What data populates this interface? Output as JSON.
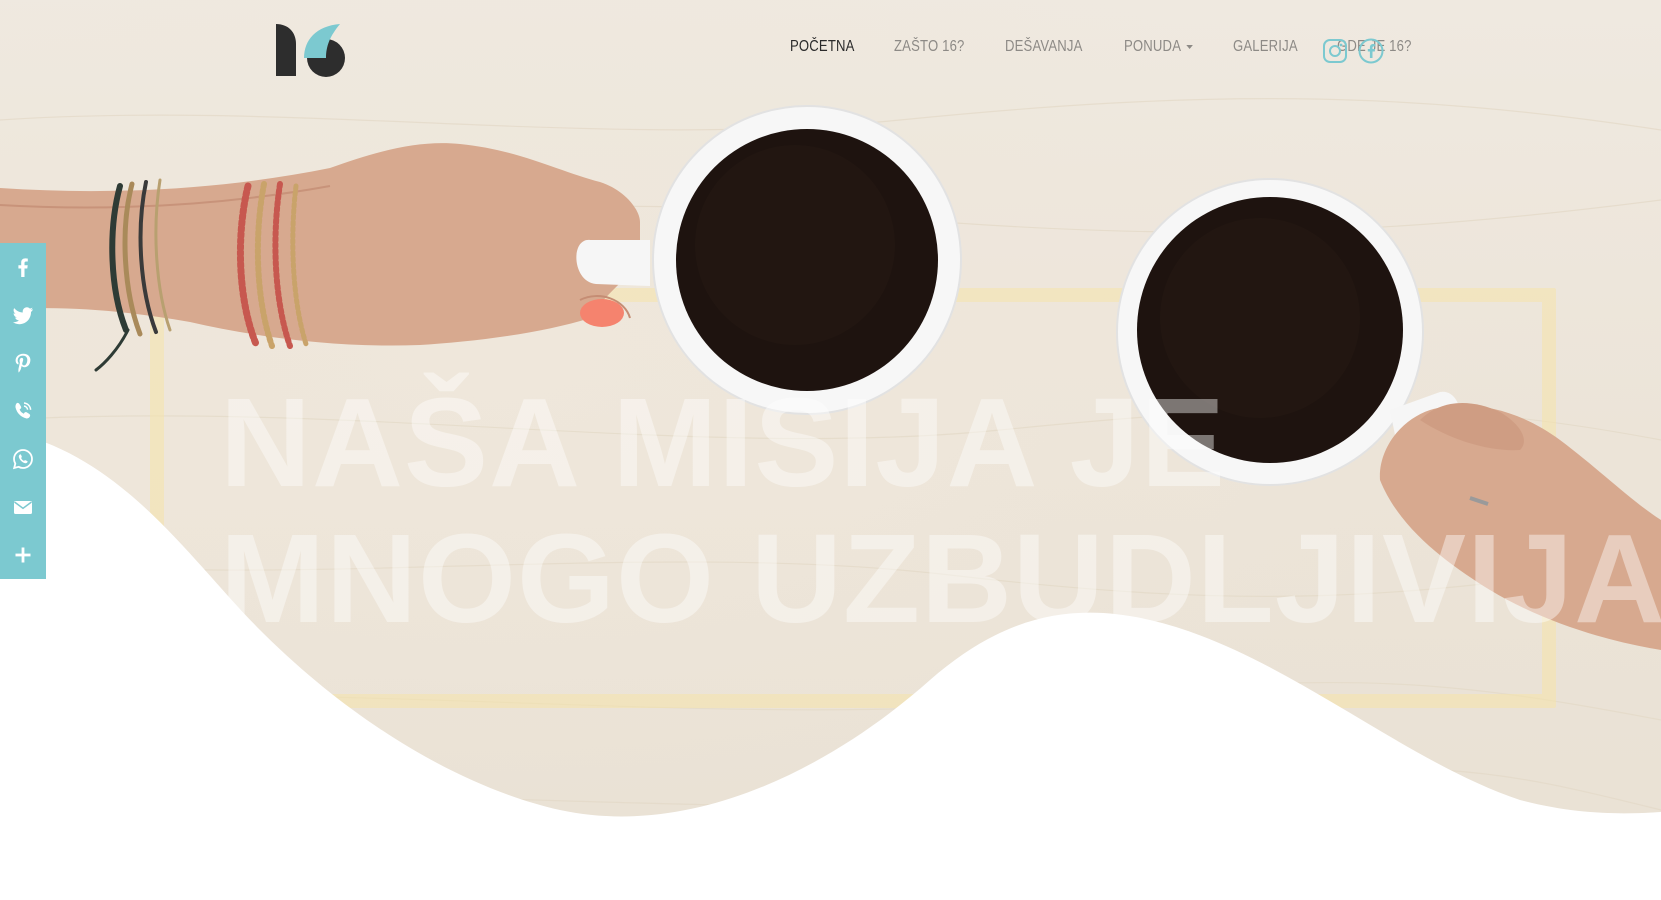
{
  "brand": {
    "logo_text": "16",
    "accent_color": "#7cc9d0",
    "logo_dark": "#2d2d2d"
  },
  "nav": {
    "items": [
      {
        "label": "POČETNA",
        "active": true
      },
      {
        "label": "ZAŠTO 16?",
        "active": false
      },
      {
        "label": "DEŠAVANJA",
        "active": false
      },
      {
        "label": "PONUDA",
        "active": false,
        "dropdown": true
      },
      {
        "label": "GALERIJA",
        "active": false
      },
      {
        "label": "GDE JE 16?",
        "active": false
      }
    ],
    "social": [
      {
        "icon": "instagram-icon"
      },
      {
        "icon": "facebook-icon"
      }
    ]
  },
  "hero": {
    "headline_line1": "NAŠA MISIJA JE",
    "headline_line2": "MNOGO UZBUDLJIVIJA"
  },
  "share_bar": {
    "color": "#7cc9d0",
    "items": [
      {
        "icon": "facebook-icon"
      },
      {
        "icon": "twitter-icon"
      },
      {
        "icon": "pinterest-icon"
      },
      {
        "icon": "viber-icon"
      },
      {
        "icon": "whatsapp-icon"
      },
      {
        "icon": "email-icon"
      },
      {
        "icon": "more-icon"
      }
    ]
  }
}
